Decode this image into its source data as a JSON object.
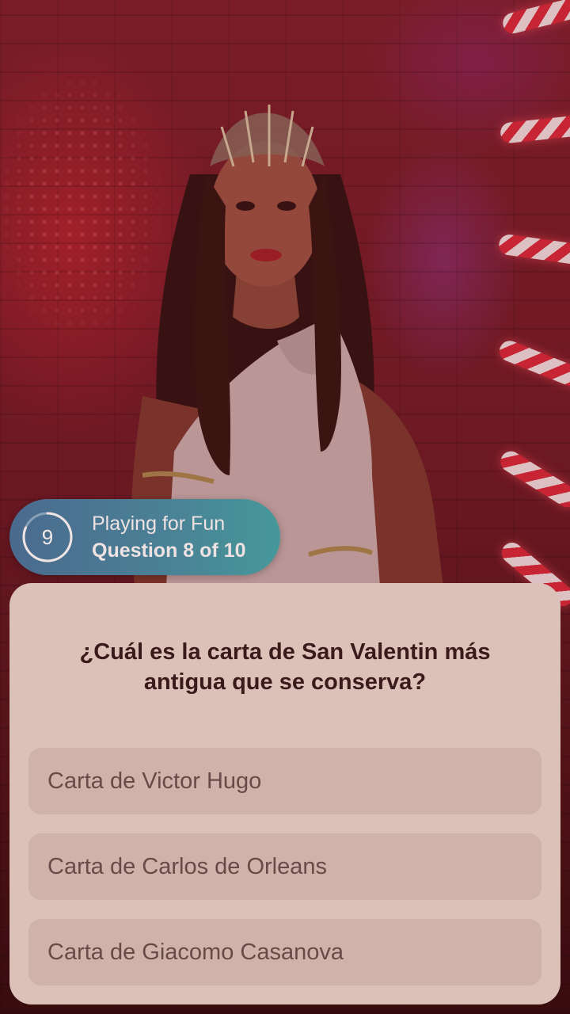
{
  "status": {
    "timer_value": "9",
    "mode_label": "Playing for Fun",
    "progress_label": "Question 8 of 10"
  },
  "question": {
    "text": "¿Cuál es la carta de San Valentin más antigua que se conserva?",
    "answers": [
      {
        "label": "Carta de Victor Hugo"
      },
      {
        "label": "Carta de Carlos de Orleans"
      },
      {
        "label": "Carta de Giacomo Casanova"
      }
    ]
  },
  "colors": {
    "pill_gradient_start": "#4a6a8e",
    "pill_gradient_end": "#46989a",
    "card_background": "#dcc1b8",
    "answer_background": "#cfb3ab",
    "question_text": "#3a1a1a",
    "answer_text": "#684a48"
  }
}
